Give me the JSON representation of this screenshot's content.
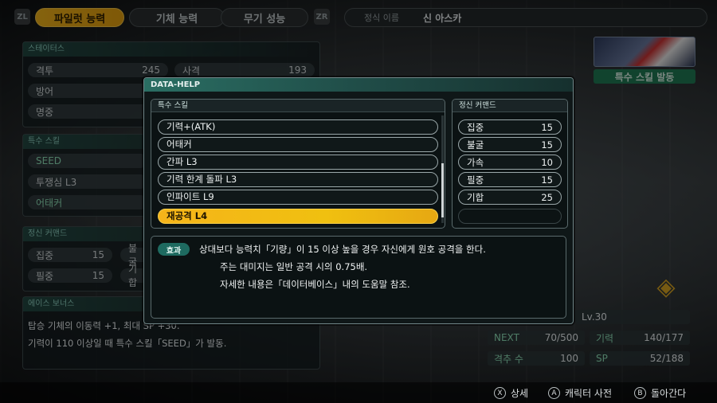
{
  "top": {
    "trigger_left": "ZL",
    "trigger_right": "ZR",
    "tabs": [
      {
        "label": "파일럿 능력",
        "active": true
      },
      {
        "label": "기체 능력",
        "active": false
      },
      {
        "label": "무기 성능",
        "active": false
      }
    ],
    "name_label": "정식 이름",
    "name_value": "신 아스카"
  },
  "left": {
    "status_header": "스테이터스",
    "stats": [
      {
        "label": "격투",
        "value": "245"
      },
      {
        "label": "사격",
        "value": "193"
      },
      {
        "label": "방어",
        "value": ""
      },
      {
        "label": "명중",
        "value": ""
      }
    ],
    "skill_header": "특수 스킬",
    "skills": [
      "SEED",
      "투쟁심 L3",
      "어태커"
    ],
    "spirit_header": "정신 커맨드",
    "spirits": [
      {
        "label": "집중",
        "value": "15"
      },
      {
        "label": "필중",
        "value": "15"
      }
    ],
    "spirit_cut": [
      "불굴",
      "기합"
    ],
    "ace_header": "에이스 보너스",
    "ace_lines": [
      "탑승 기체의 이동력 +1, 최대 SP +30.",
      "기력이 110 이상일 때 특수 스킬「SEED」가 발동."
    ]
  },
  "right": {
    "badge": "특수 스킬 발동",
    "level": "Lv.30",
    "next_label": "NEXT",
    "next_value": "70/500",
    "morale_label": "기력",
    "morale_value": "140/177",
    "kills_label": "격추 수",
    "kills_value": "100",
    "sp_label": "SP",
    "sp_value": "52/188"
  },
  "modal": {
    "title": "DATA-HELP",
    "skills_header": "특수 스킬",
    "skills": [
      {
        "label": "기력+(ATK)",
        "selected": false
      },
      {
        "label": "어태커",
        "selected": false
      },
      {
        "label": "간파 L3",
        "selected": false
      },
      {
        "label": "기력 한계 돌파 L3",
        "selected": false
      },
      {
        "label": "인파이트 L9",
        "selected": false
      },
      {
        "label": "재공격 L4",
        "selected": true
      }
    ],
    "spirit_header": "정신 커맨드",
    "spirits": [
      {
        "label": "집중",
        "value": "15"
      },
      {
        "label": "불굴",
        "value": "15"
      },
      {
        "label": "가속",
        "value": "10"
      },
      {
        "label": "필중",
        "value": "15"
      },
      {
        "label": "기합",
        "value": "25"
      }
    ],
    "effect_tag": "효과",
    "effect_lines": [
      "상대보다 능력치「기량」이 15 이상 높을 경우 자신에게 원호 공격을 한다.",
      "주는 대미지는 일반 공격 시의 0.75배.",
      "자세한 내용은「데이터베이스」내의 도움말 참조."
    ]
  },
  "bottom": {
    "hints": [
      {
        "button": "X",
        "label": "상세"
      },
      {
        "button": "A",
        "label": "캐릭터 사전"
      },
      {
        "button": "B",
        "label": "돌아간다"
      }
    ]
  },
  "colors": {
    "accent_gold": "#f2b31a",
    "accent_teal": "#2a6e63",
    "badge_green": "#1f7a55"
  }
}
